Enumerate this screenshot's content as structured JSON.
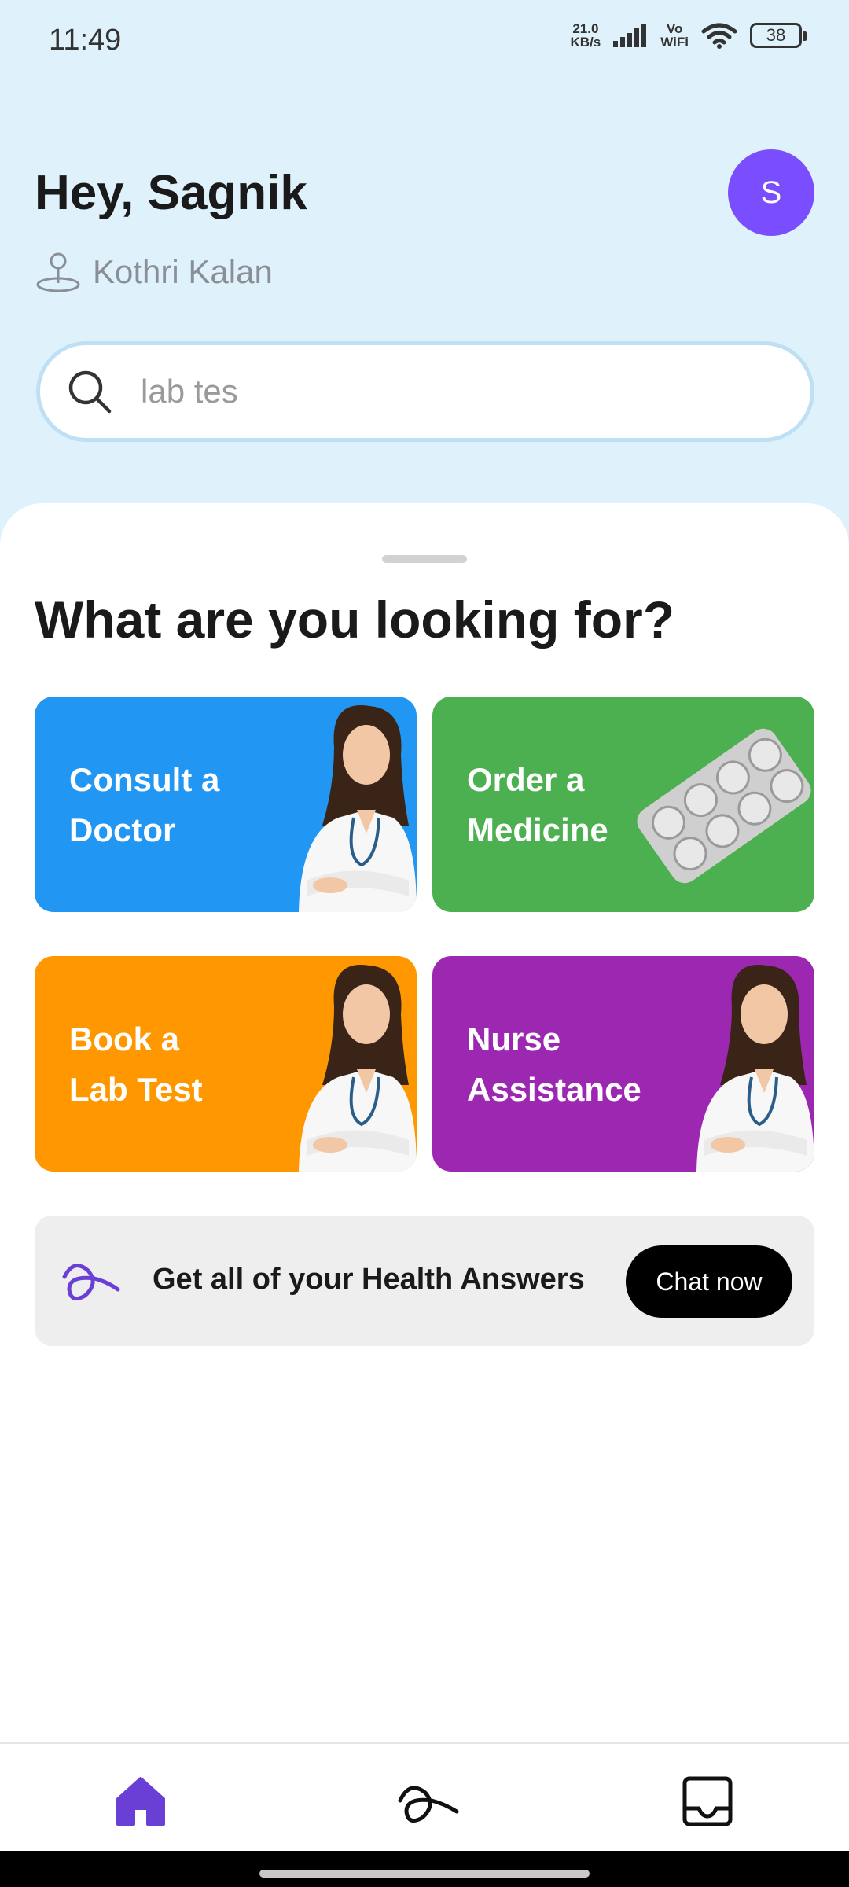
{
  "status_bar": {
    "time": "11:49",
    "speed_value": "21.0",
    "speed_unit": "KB/s",
    "vo": "Vo",
    "wifi_label": "WiFi",
    "battery": "38"
  },
  "header": {
    "greeting": "Hey, Sagnik",
    "location": "Kothri Kalan",
    "avatar_initial": "S"
  },
  "search": {
    "value": "lab tes"
  },
  "main": {
    "section_title": "What are you looking for?",
    "cards": [
      {
        "label": "Consult a\nDoctor",
        "color": "#2196f3",
        "icon": "doctor-image"
      },
      {
        "label": "Order a\nMedicine",
        "color": "#4caf50",
        "icon": "pill-blister-image"
      },
      {
        "label": "Book a\nLab Test",
        "color": "#ff9800",
        "icon": "doctor-image"
      },
      {
        "label": "Nurse\nAssistance",
        "color": "#9c27b0",
        "icon": "doctor-image"
      }
    ],
    "chat": {
      "text": "Get all of your Health Answers",
      "button": "Chat now"
    }
  },
  "bottom_nav": {
    "items": [
      {
        "icon": "home-icon",
        "active": true
      },
      {
        "icon": "assistant-logo-icon",
        "active": false
      },
      {
        "icon": "inbox-icon",
        "active": false
      }
    ]
  },
  "colors": {
    "accent": "#7a4dff",
    "header_bg": "#dff1fa"
  }
}
